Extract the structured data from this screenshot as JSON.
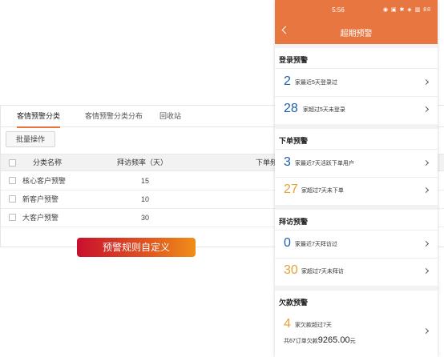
{
  "desktop": {
    "tabs": [
      "客情预警分类",
      "客情预警分类分布",
      "回收站"
    ],
    "batch_button": "批量操作",
    "columns": [
      "分类名称",
      "拜访频率（天）",
      "下单频"
    ],
    "rows": [
      {
        "name": "核心客户预警",
        "frequency": "15"
      },
      {
        "name": "新客户预警",
        "frequency": "10"
      },
      {
        "name": "大客户预警",
        "frequency": "30"
      }
    ]
  },
  "banner": "预警规则自定义",
  "phone": {
    "status_time": "5:56",
    "status_icons": "◉ ▣ ✱ ◈ ▥ 88",
    "nav_title": "超期预警",
    "sections": [
      {
        "title": "登录预警",
        "items": [
          {
            "num": "2",
            "color": "blue",
            "text": "家最近5天登录过"
          },
          {
            "num": "28",
            "color": "blue",
            "text": "家超过5天未登录"
          }
        ]
      },
      {
        "title": "下单预警",
        "items": [
          {
            "num": "3",
            "color": "blue",
            "text": "家最近7天活跃下单用户"
          },
          {
            "num": "27",
            "color": "orange",
            "text": "家超过7天未下单"
          }
        ]
      },
      {
        "title": "拜访预警",
        "items": [
          {
            "num": "0",
            "color": "blue",
            "text": "家最近7天拜访过"
          },
          {
            "num": "30",
            "color": "orange",
            "text": "家超过7天未拜访"
          }
        ]
      },
      {
        "title": "欠款预警",
        "items": [
          {
            "num": "4",
            "color": "orange",
            "text": "家欠款超过7天"
          }
        ],
        "sub_prefix": "共67订单欠款",
        "sub_amount": "9265.00",
        "sub_suffix": "元"
      }
    ]
  },
  "colors": {
    "header": "#e87640",
    "blue": "#1b5fa8",
    "orange": "#e5a23a",
    "tab_accent": "#e8743b"
  }
}
